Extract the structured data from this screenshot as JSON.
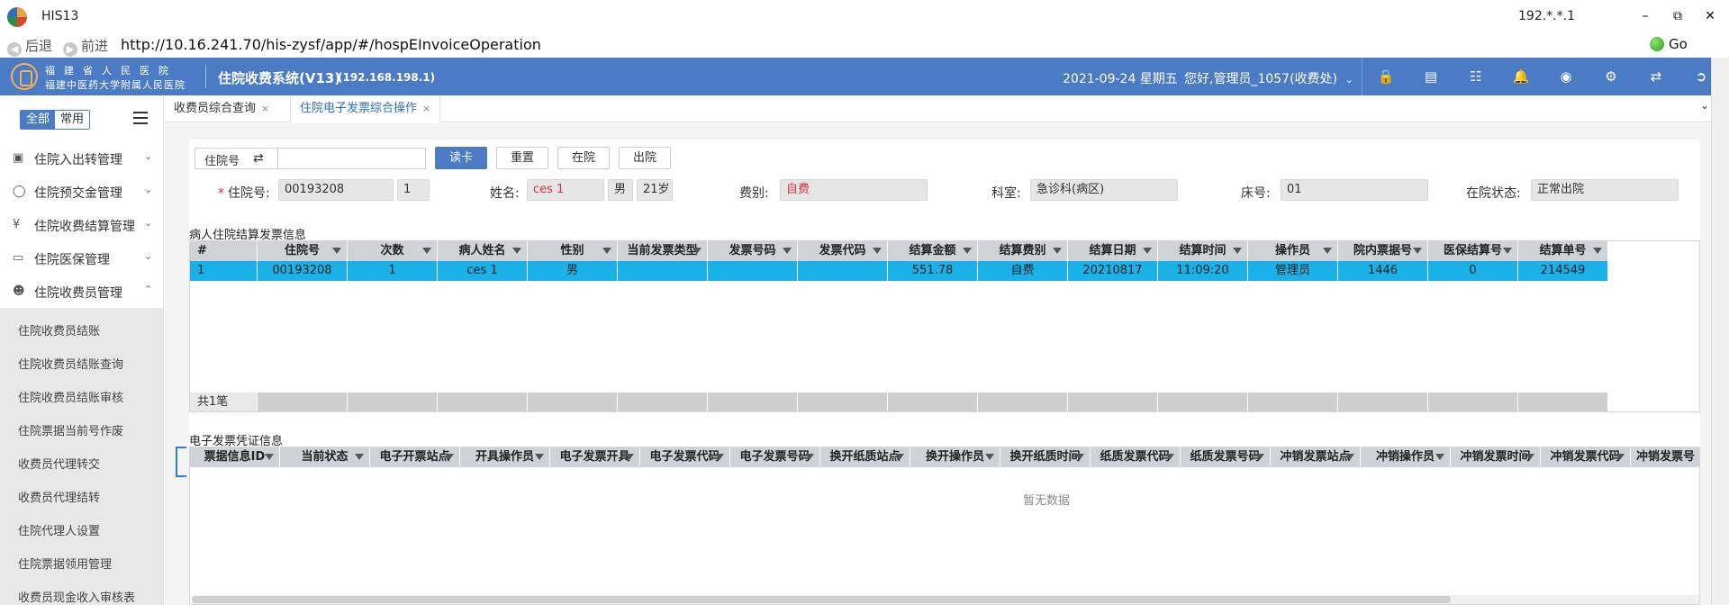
{
  "window": {
    "title": "HIS13",
    "ip": "192.*.*.1"
  },
  "browser": {
    "back": "后退",
    "forward": "前进",
    "url": "http://10.16.241.70/his-zysf/app/#/hospEInvoiceOperation",
    "go": "Go"
  },
  "header": {
    "hospital_line1": "福建省人民医院",
    "hospital_line2": "福建中医药大学附属人民医院",
    "system_title": "住院收费系统(V13)",
    "system_ip": "(192.168.198.1)",
    "date": "2021-09-24 星期五",
    "user": "您好,管理员_1057(收费处)"
  },
  "sidebar": {
    "toggle_all": "全部",
    "toggle_common": "常用",
    "groups": [
      {
        "label": "住院入出转管理",
        "icon": "bed-icon",
        "expanded": false
      },
      {
        "label": "住院预交金管理",
        "icon": "coin-icon",
        "expanded": false
      },
      {
        "label": "住院收费结算管理",
        "icon": "yen-icon",
        "expanded": false
      },
      {
        "label": "住院医保管理",
        "icon": "card-icon",
        "expanded": false
      },
      {
        "label": "住院收费员管理",
        "icon": "user-icon",
        "expanded": true
      }
    ],
    "sub_items": [
      "住院收费员结账",
      "住院收费员结账查询",
      "住院收费员结账审核",
      "住院票据当前号作废",
      "收费员代理转交",
      "收费员代理结转",
      "住院代理人设置",
      "住院票据领用管理",
      "收费员现金收入审核表"
    ]
  },
  "tabs": [
    {
      "label": "收费员综合查询",
      "close": "×",
      "active": false
    },
    {
      "label": "住院电子发票综合操作",
      "close": "×",
      "active": true
    }
  ],
  "search": {
    "select_label": "住院号",
    "swap_icon": "⇄",
    "input_value": "",
    "btn_read": "读卡",
    "btn_reset": "重置",
    "btn_inhosp": "在院",
    "btn_discharged": "出院"
  },
  "patient": {
    "required_mark": "*",
    "hosp_no_label": "住院号:",
    "hosp_no": "00193208",
    "times": "1",
    "name_label": "姓名:",
    "name": "ces 1",
    "sex": "男",
    "age": "21岁",
    "fee_label": "费别:",
    "fee_type": "自费",
    "dept_label": "科室:",
    "dept": "急诊科(病区)",
    "bed_label": "床号:",
    "bed": "01",
    "status_label": "在院状态:",
    "status": "正常出院"
  },
  "settlement": {
    "title": "病人住院结算发票信息",
    "columns": [
      "#",
      "住院号",
      "次数",
      "病人姓名",
      "性别",
      "当前发票类型",
      "发票号码",
      "发票代码",
      "结算金额",
      "结算费别",
      "结算日期",
      "结算时间",
      "操作员",
      "院内票据号",
      "医保结算号",
      "结算单号"
    ],
    "rows": [
      [
        "1",
        "00193208",
        "1",
        "ces 1",
        "男",
        "",
        "",
        "",
        "551.78",
        "自费",
        "20210817",
        "11:09:20",
        "管理员",
        "1446",
        "0",
        "214549"
      ]
    ],
    "footer": "共1笔"
  },
  "einvoice": {
    "title": "电子发票凭证信息",
    "columns": [
      "票据信息ID",
      "当前状态",
      "电子开票站点",
      "开具操作员",
      "电子发票开具",
      "电子发票代码",
      "电子发票号码",
      "换开纸质站点",
      "换开操作员",
      "换开纸质时间",
      "纸质发票代码",
      "纸质发票号码",
      "冲销发票站点",
      "冲销操作员",
      "冲销发票时间",
      "冲销发票代码",
      "冲销发票号"
    ],
    "empty": "暂无数据"
  },
  "colors": {
    "brand": "#4a7bc4",
    "selected_row": "#1ab0e8",
    "required": "#e03030"
  }
}
